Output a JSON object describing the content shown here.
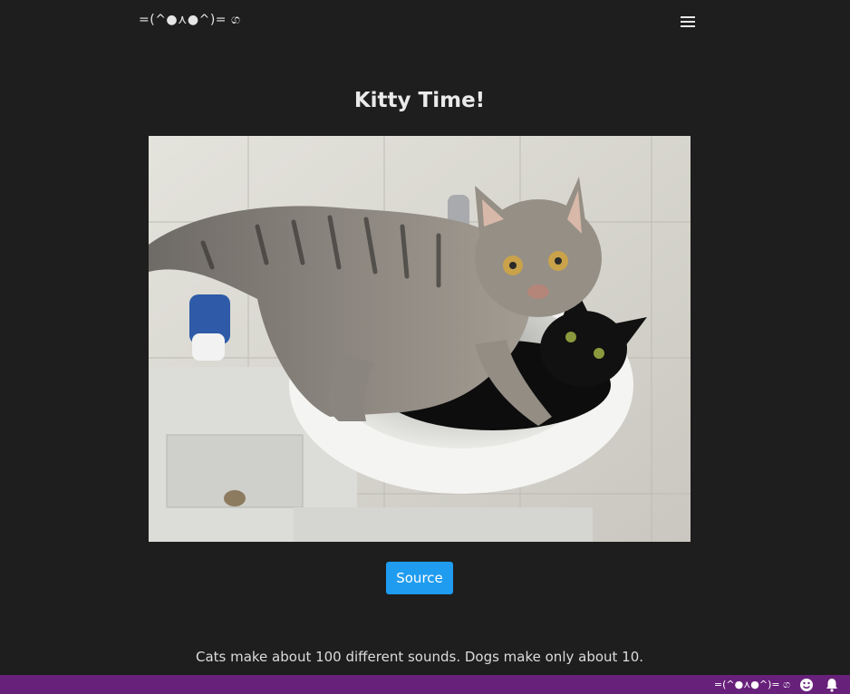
{
  "navbar": {
    "brand": "=(^●⋏●^)= ග",
    "menu_icon": "hamburger-menu-icon"
  },
  "main": {
    "title": "Kitty Time!",
    "image": {
      "alt": "Two cats in a bathroom sink"
    },
    "source_button": "Source",
    "fact": "Cats make about 100 different sounds. Dogs make only about 10."
  },
  "statusbar": {
    "text": "=(^●⋏●^)= ග",
    "icons": [
      "smiley-icon",
      "bell-icon"
    ],
    "color": "#68217a"
  },
  "colors": {
    "background": "#1e1e1e",
    "button": "#1f9cf0",
    "statusbar": "#68217a"
  }
}
